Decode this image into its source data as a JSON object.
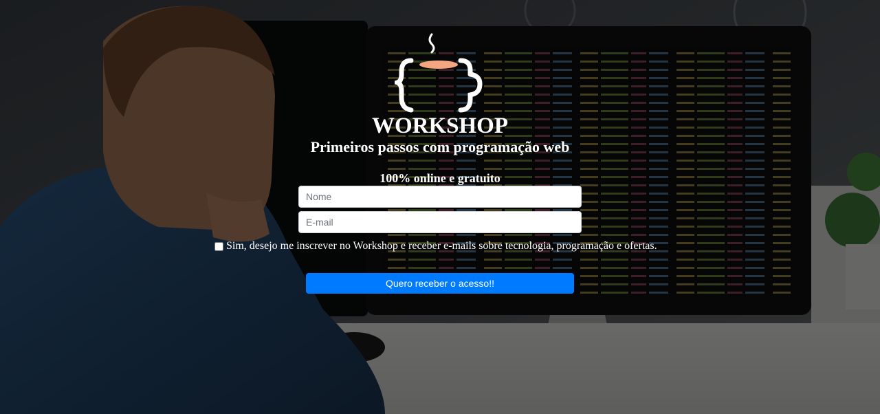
{
  "hero": {
    "title": "WORKSHOP",
    "subtitle": "Primeiros passos com programação web",
    "tagline": "100% online e gratuito"
  },
  "form": {
    "name_placeholder": "Nome",
    "name_value": "",
    "email_placeholder": "E-mail",
    "email_value": "",
    "consent_label": "Sim, desejo me inscrever no Workshop e receber e-mails sobre tecnologia, programação e ofertas.",
    "consent_checked": false,
    "submit_label": "Quero receber o acesso!!"
  },
  "colors": {
    "primary_button": "#007bff",
    "logo_cup": "#ffffff",
    "logo_coffee": "#f4a582",
    "overlay": "rgba(0,0,0,0.55)"
  },
  "icons": {
    "logo": "coffee-cup-braces-logo"
  }
}
